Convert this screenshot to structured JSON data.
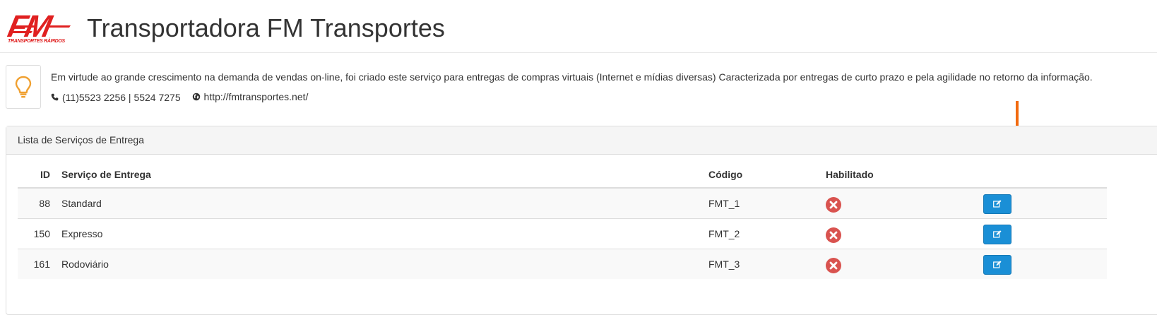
{
  "header": {
    "logo_text": "FM",
    "logo_tagline": "TRANSPORTES RÁPIDOS",
    "title": "Transportadora FM Transportes"
  },
  "info": {
    "icon": "lightbulb-icon",
    "description": "Em virtude ao grande crescimento na demanda de vendas on-line, foi criado este serviço para entregas de compras virtuais (Internet e mídias diversas) Caracterizada por entregas de curto prazo e pela agilidade no retorno da informação.",
    "phone": "(11)5523 2256 | 5524 7275",
    "website": "http://fmtransportes.net/"
  },
  "panel": {
    "heading": "Lista de Serviços de Entrega",
    "columns": [
      "ID",
      "Serviço de Entrega",
      "Código",
      "Habilitado"
    ],
    "rows": [
      {
        "id": "88",
        "name": "Standard",
        "code": "FMT_1",
        "enabled": false
      },
      {
        "id": "150",
        "name": "Expresso",
        "code": "FMT_2",
        "enabled": false
      },
      {
        "id": "161",
        "name": "Rodoviário",
        "code": "FMT_3",
        "enabled": false
      }
    ]
  },
  "colors": {
    "brand_red": "#e02020",
    "edit_button": "#1a8fd6",
    "disabled_icon": "#d9534f",
    "annotation_arrow": "#f26a0f",
    "bulb": "#f0a030"
  }
}
